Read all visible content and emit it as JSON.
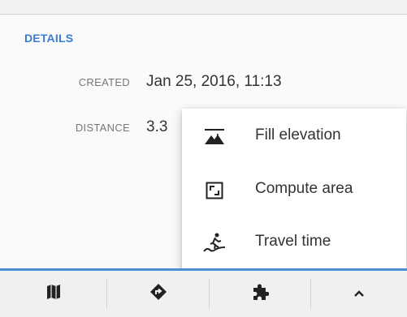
{
  "details": {
    "section_title": "DETAILS",
    "created_label": "CREATED",
    "created_value": "Jan 25, 2016, 11:13",
    "distance_label": "DISTANCE",
    "distance_value": "3.3"
  },
  "menu": {
    "items": [
      {
        "label": "Fill elevation",
        "icon": "fill-elevation-icon"
      },
      {
        "label": "Compute area",
        "icon": "compute-area-icon"
      },
      {
        "label": "Travel time",
        "icon": "travel-time-icon"
      }
    ]
  },
  "bottom_tabs": [
    {
      "icon": "map-icon"
    },
    {
      "icon": "directions-icon"
    },
    {
      "icon": "puzzle-icon"
    },
    {
      "icon": "chevron-up-icon"
    }
  ],
  "colors": {
    "accent": "#4a90d9",
    "section_title": "#3a7bd5",
    "text": "#333333",
    "label": "#777777"
  }
}
